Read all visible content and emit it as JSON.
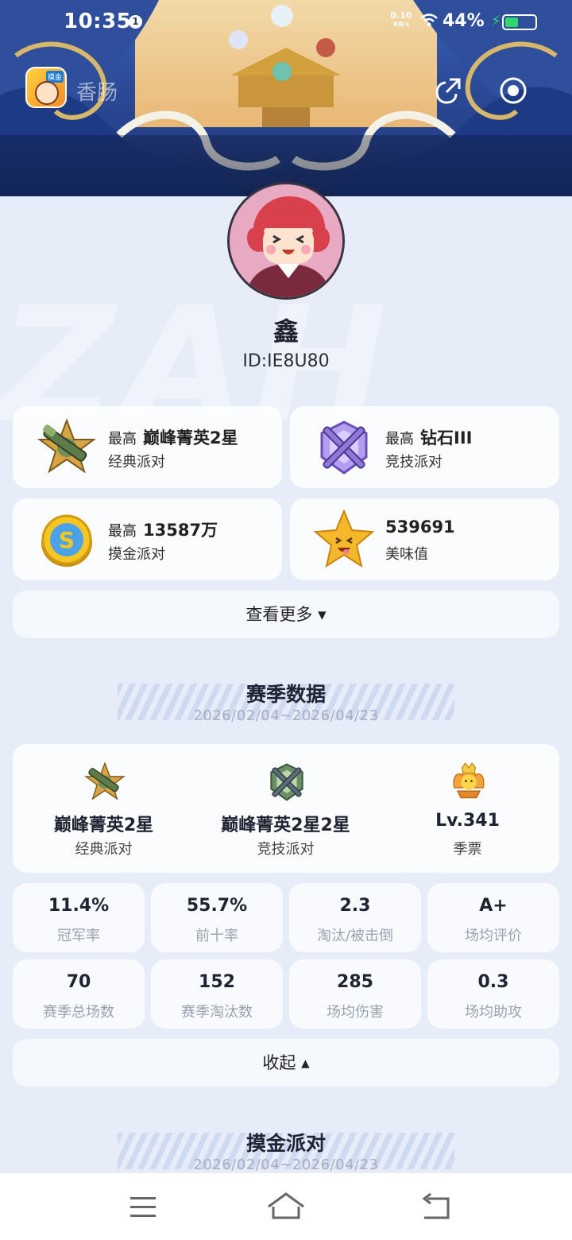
{
  "status_bar": {
    "time": "10:35",
    "notification_count": "1",
    "net_speed_value": "0.10",
    "net_speed_unit": "KB/s",
    "battery_percent": "44%",
    "battery_level": 0.44,
    "charging_color": "#33d46b"
  },
  "app_bar": {
    "title": "香肠",
    "logo_tag": "摸金",
    "share_icon": "share-icon",
    "target_icon": "target-icon"
  },
  "profile": {
    "name": "鑫",
    "id_text": "ID:IE8U80",
    "background_letters": "ZAH"
  },
  "rank_cards": [
    {
      "prefix": "最高",
      "value": "巅峰菁英2星",
      "mode": "经典派对",
      "icon": "classic-rank-badge-icon"
    },
    {
      "prefix": "最高",
      "value": "钻石III",
      "mode": "竞技派对",
      "icon": "competitive-rank-badge-icon"
    },
    {
      "prefix": "最高",
      "value": "13587万",
      "mode": "摸金派对",
      "icon": "gold-coin-icon"
    },
    {
      "prefix": "",
      "value": "539691",
      "mode": "美味值",
      "icon": "smiling-star-icon"
    }
  ],
  "more_button": {
    "label": "查看更多",
    "arrow": "▾"
  },
  "season_section": {
    "title": "赛季数据",
    "date_range": "2026/02/04~2026/04/23",
    "highlights": [
      {
        "value": "巅峰菁英2星",
        "label": "经典派对",
        "icon": "classic-rank-badge-icon"
      },
      {
        "value": "巅峰菁英2星2星",
        "label": "竞技派对",
        "icon": "competitive-rank-badge-icon"
      },
      {
        "value": "Lv.341",
        "label": "季票",
        "icon": "season-pass-crown-icon"
      }
    ],
    "stats": [
      {
        "value": "11.4%",
        "label": "冠军率"
      },
      {
        "value": "55.7%",
        "label": "前十率"
      },
      {
        "value": "2.3",
        "label": "淘汰/被击倒"
      },
      {
        "value": "A+",
        "label": "场均评价"
      },
      {
        "value": "70",
        "label": "赛季总场数"
      },
      {
        "value": "152",
        "label": "赛季淘汰数"
      },
      {
        "value": "285",
        "label": "场均伤害"
      },
      {
        "value": "0.3",
        "label": "场均助攻"
      }
    ],
    "collapse_label": "收起",
    "collapse_arrow": "▴"
  },
  "gold_section": {
    "title": "摸金派对",
    "date_range": "2026/02/04~2026/04/23"
  },
  "nav_bar": {
    "menu_icon": "menu-icon",
    "home_icon": "home-icon",
    "back_icon": "back-icon"
  }
}
